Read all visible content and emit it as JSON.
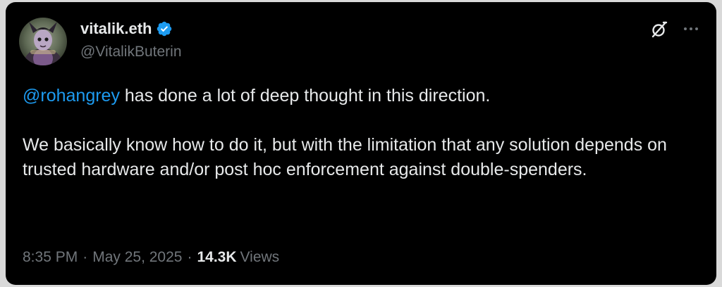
{
  "author": {
    "display_name": "vitalik.eth",
    "handle": "@VitalikButerin",
    "verified": true
  },
  "tweet": {
    "mention": "@rohangrey",
    "paragraph1_rest": " has done a lot of deep thought in this direction.",
    "paragraph2": "We basically know how to do it, but with the limitation that any solution depends on trusted hardware and/or post hoc enforcement against double-spenders."
  },
  "meta": {
    "time": "8:35 PM",
    "separator": "·",
    "date": "May 25, 2025",
    "views_count": "14.3K",
    "views_label": "Views"
  },
  "icons": {
    "grok": "grok-icon",
    "more": "more-icon",
    "verified": "verified-badge-icon"
  },
  "colors": {
    "background": "#000000",
    "text": "#e7e9ea",
    "secondary": "#71767b",
    "link": "#1d9bf0",
    "verified": "#1d9bf0"
  }
}
